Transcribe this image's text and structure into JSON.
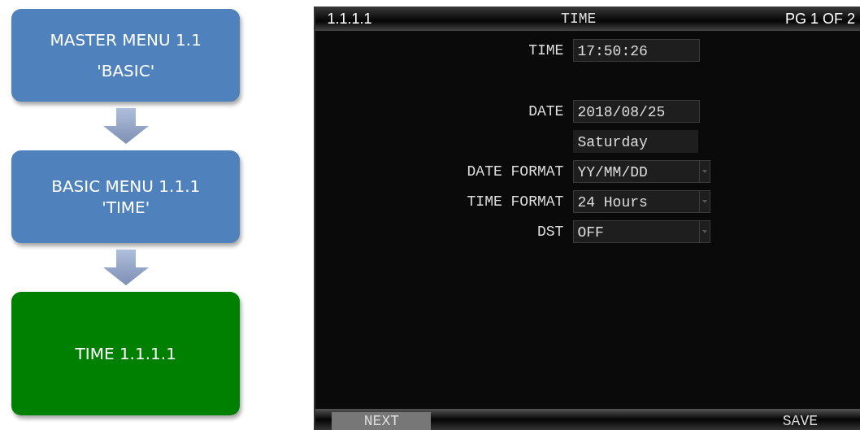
{
  "flow": [
    {
      "label": "MASTER MENU 1.1",
      "sub": "'BASIC'",
      "color": "#4f81bd"
    },
    {
      "label": "BASIC MENU 1.1.1",
      "sub": "'TIME'",
      "color": "#4f81bd"
    },
    {
      "label": "TIME 1.1.1.1",
      "color": "#008000"
    }
  ],
  "screen": {
    "header": {
      "menu_id": "1.1.1.1",
      "title": "TIME",
      "page": "PG 1 OF 2"
    },
    "fields": [
      {
        "label": "TIME",
        "value": "17:50:26",
        "kind": "text"
      },
      {
        "label": "DATE",
        "value": "2018/08/25",
        "kind": "text"
      },
      {
        "value": "Saturday",
        "kind": "readout"
      },
      {
        "label": "DATE FORMAT",
        "value": "YY/MM/DD",
        "kind": "select"
      },
      {
        "label": "TIME FORMAT",
        "value": "24 Hours",
        "kind": "select"
      },
      {
        "label": "DST",
        "value": "OFF",
        "kind": "select"
      }
    ],
    "footer": {
      "left": "NEXT",
      "right": "SAVE"
    }
  }
}
